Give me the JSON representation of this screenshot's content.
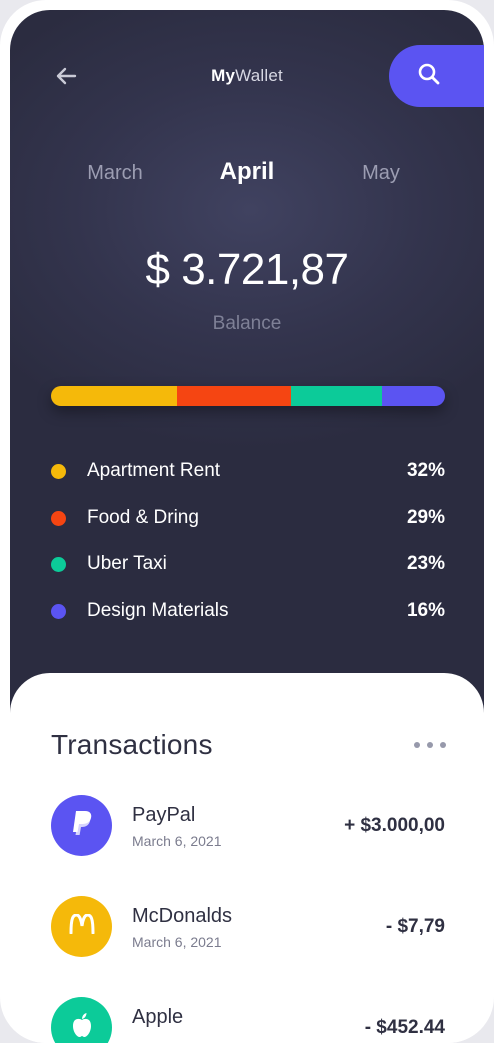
{
  "header": {
    "title_bold": "My",
    "title_light": "Wallet"
  },
  "months": [
    {
      "label": "March",
      "active": false
    },
    {
      "label": "April",
      "active": true
    },
    {
      "label": "May",
      "active": false
    }
  ],
  "balance": {
    "amount": "$ 3.721,87",
    "label": "Balance"
  },
  "breakdown": [
    {
      "name": "Apartment Rent",
      "percent": "32%",
      "share": 32,
      "color": "#f5b90a"
    },
    {
      "name": "Food & Dring",
      "percent": "29%",
      "share": 29,
      "color": "#f54512"
    },
    {
      "name": "Uber Taxi",
      "percent": "23%",
      "share": 23,
      "color": "#0ccb99"
    },
    {
      "name": "Design Materials",
      "percent": "16%",
      "share": 16,
      "color": "#5b54f2"
    }
  ],
  "transactions": {
    "title": "Transactions",
    "items": [
      {
        "merchant": "PayPal",
        "date": "March 6, 2021",
        "amount": "+ $3.000,00",
        "icon": "paypal-icon",
        "color": "#5b54f2"
      },
      {
        "merchant": "McDonalds",
        "date": "March 6, 2021",
        "amount": "- $7,79",
        "icon": "mcdonalds-icon",
        "color": "#f5b90a"
      },
      {
        "merchant": "Apple",
        "date": "",
        "amount": "- $452.44",
        "icon": "apple-icon",
        "color": "#0ccb99"
      }
    ]
  },
  "colors": {
    "accent": "#5b54f2",
    "dark_bg": "#33344d"
  }
}
